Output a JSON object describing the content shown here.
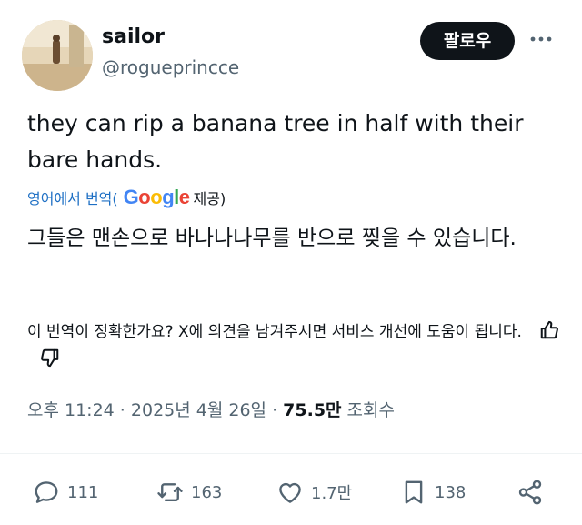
{
  "user": {
    "name": "sailor",
    "handle": "@rogueprincce",
    "follow_label": "팔로우"
  },
  "tweet": {
    "text": "they can rip a banana tree in half with their bare hands."
  },
  "translation": {
    "prefix": "영어에서 번역(",
    "provider": "Google",
    "suffix": " 제공)",
    "text": "그들은 맨손으로 바나나나무를 반으로 찢을 수 있습니다."
  },
  "feedback": {
    "prompt": "이 번역이 정확한가요? X에 의견을 남겨주시면 서비스 개선에 도움이 됩니다."
  },
  "meta": {
    "time": "오후 11:24",
    "sep1": " · ",
    "date": "2025년 4월 26일",
    "sep2": " · ",
    "views": "75.5만",
    "views_label": " 조회수"
  },
  "actions": {
    "replies": "111",
    "reposts": "163",
    "likes": "1.7만",
    "bookmarks": "138"
  },
  "icons": {
    "more": "more-horizontal-icon",
    "reply": "reply-icon",
    "repost": "repost-icon",
    "like": "heart-icon",
    "bookmark": "bookmark-icon",
    "share": "share-icon",
    "thumbs_up": "thumbs-up-icon",
    "thumbs_down": "thumbs-down-icon"
  },
  "colors": {
    "text": "#0f1419",
    "secondary": "#536471",
    "link": "#1d6fc4",
    "button_bg": "#0f1419"
  }
}
